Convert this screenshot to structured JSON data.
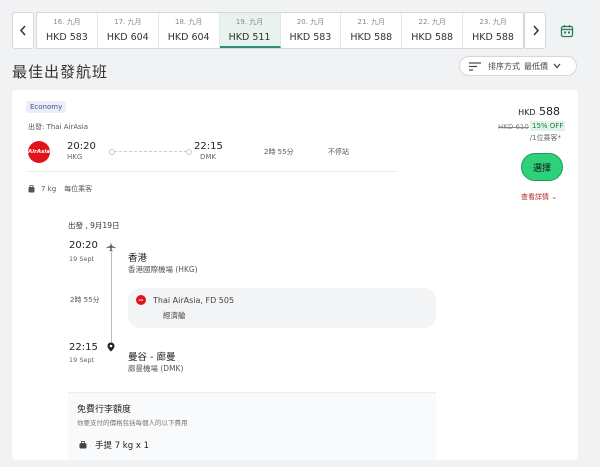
{
  "dates": [
    {
      "label": "16. 九月",
      "price": "HKD 583"
    },
    {
      "label": "17. 九月",
      "price": "HKD 604"
    },
    {
      "label": "18. 九月",
      "price": "HKD 604"
    },
    {
      "label": "19. 九月",
      "price": "HKD 511"
    },
    {
      "label": "20. 九月",
      "price": "HKD 583"
    },
    {
      "label": "21. 九月",
      "price": "HKD 588"
    },
    {
      "label": "22. 九月",
      "price": "HKD 588"
    },
    {
      "label": "23. 九月",
      "price": "HKD 588"
    }
  ],
  "page_title": "最佳出發航班",
  "sort": {
    "label": "排序方式",
    "value": "最低價"
  },
  "flight": {
    "cabin": "Economy",
    "depart_label": "出發: Thai AirAsia",
    "airline_logo_text": "AirAsia",
    "dep_time": "20:20",
    "dep_airport": "HKG",
    "arr_time": "22:15",
    "arr_airport": "DMK",
    "duration": "2時 55分",
    "stops": "不停站",
    "baggage_kg": "7 kg",
    "baggage_note": "每位乘客"
  },
  "price": {
    "currency": "HKD",
    "amount": "588",
    "old": "HKD 610",
    "discount": "15% OFF",
    "per_person": "/1位乘客*",
    "select_label": "選擇",
    "details_label": "查看詳情"
  },
  "details": {
    "title": "出發 , 9月19日",
    "dep_time": "20:20",
    "dep_date": "19 Sept",
    "dep_city": "香港",
    "dep_airport": "香港國際機場 (HKG)",
    "duration": "2時 55分",
    "segment_airline": "Thai AirAsia, FD 505",
    "segment_class": "經濟艙",
    "arr_time": "22:15",
    "arr_date": "19 Sept",
    "arr_city": "曼谷 - 廊曼",
    "arr_airport": "廊曼機場 (DMK)"
  },
  "baggage": {
    "title": "免費行李額度",
    "subtitle": "你要支付的價格包括每個人的以下費用",
    "item": "手提 7 kg x 1"
  }
}
